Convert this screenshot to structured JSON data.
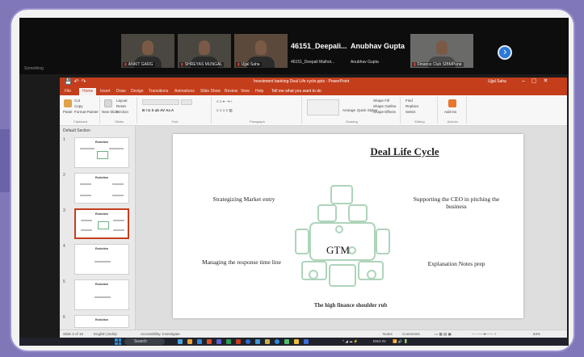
{
  "meeting": {
    "left_label": "Something",
    "participants": [
      {
        "name": "ANKIT GARG",
        "avatar_icon": "person-avatar"
      },
      {
        "name": "SHREYAS MUNGAL",
        "avatar_icon": "person-avatar"
      },
      {
        "name": "Ujjal Saha",
        "avatar_icon": "person-avatar"
      },
      {
        "name": "Finance Club SIBMPune",
        "avatar_icon": "person-avatar"
      }
    ],
    "text_tiles": [
      {
        "name": "46151_Deepali...",
        "sub": "46151_Deepali Malhot..."
      },
      {
        "name": "Anubhav Gupta",
        "sub": "Anubhav Gupta"
      }
    ],
    "more_icon": "chevron-right-icon"
  },
  "powerpoint": {
    "doc_title": "Investment banking Deal Life cycle.pptx - PowerPoint",
    "user": "Ujjal Saha",
    "tabs": [
      "File",
      "Home",
      "Insert",
      "Draw",
      "Design",
      "Transitions",
      "Animations",
      "Slide Show",
      "Review",
      "View",
      "Help"
    ],
    "tell_me": "Tell me what you want to do",
    "ribbon": {
      "clipboard": {
        "paste": "Paste",
        "cut": "Cut",
        "copy": "Copy",
        "format_painter": "Format Painter",
        "group": "Clipboard"
      },
      "slides": {
        "new_slide": "New Slide",
        "layout": "Layout",
        "reset": "Reset",
        "section": "Section",
        "group": "Slides"
      },
      "font_group": "Font",
      "paragraph_group": "Paragraph",
      "drawing": {
        "arrange": "Arrange",
        "quick_styles": "Quick Styles",
        "shape_fill": "Shape Fill",
        "shape_outline": "Shape Outline",
        "shape_effects": "Shape Effects",
        "group": "Drawing"
      },
      "editing": {
        "find": "Find",
        "replace": "Replace",
        "select": "Select",
        "group": "Editing"
      },
      "addins": {
        "label": "Add-ins",
        "group": "Add-ins"
      }
    },
    "section_label": "Default Section",
    "thumbnails": [
      {
        "num": "1",
        "title": "Evolution"
      },
      {
        "num": "2",
        "title": "Evolution"
      },
      {
        "num": "3",
        "title": "Evolution"
      },
      {
        "num": "4",
        "title": "Evolution"
      },
      {
        "num": "5",
        "title": "Evolution"
      },
      {
        "num": "6",
        "title": "Evolution"
      }
    ],
    "slide": {
      "title": "Deal Life Cycle",
      "top_left": "Strategizing Market entry",
      "top_right": "Supporting the CEO in pitching the business",
      "bottom_left": "Managing the response time line",
      "bottom_right": "Explanation Notes prep",
      "center": "GTM",
      "caption": "The high finance shoulder rub",
      "accent_color": "#6cb283"
    },
    "status": {
      "slide_of": "Slide 3 of 15",
      "language": "English (India)",
      "accessibility": "Accessibility: Investigate",
      "notes": "Notes",
      "comments": "Comments",
      "zoom": "64%"
    }
  },
  "taskbar": {
    "search": "Search",
    "tray_lang": "ENG IN"
  }
}
